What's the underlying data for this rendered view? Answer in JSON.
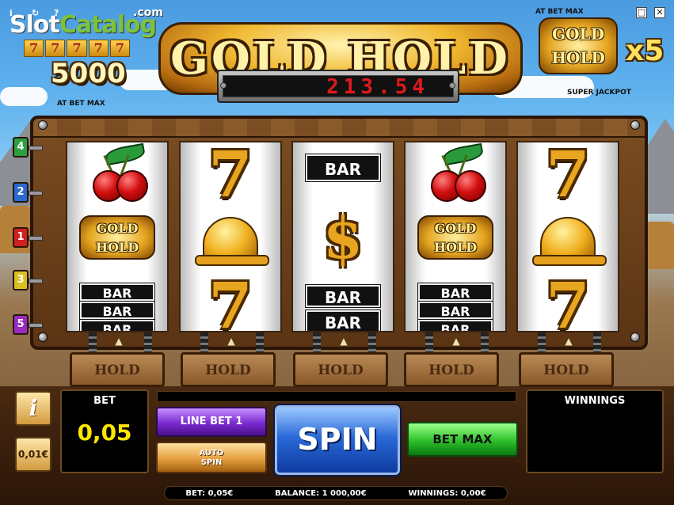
{
  "watermark": {
    "brand_a": "Slot",
    "brand_b": "Catalog",
    "suffix": ".com"
  },
  "window_controls": {
    "info": "i",
    "help": "?",
    "restore": "□",
    "close": "✕"
  },
  "left_jackpot": {
    "sevens": [
      "7",
      "7",
      "7",
      "7",
      "7"
    ],
    "value": "5000",
    "caption": "AT BET MAX"
  },
  "title": {
    "text": "GOLD HOLD"
  },
  "led_display": {
    "value": "213.54"
  },
  "right_jackpot": {
    "top_caption": "AT BET MAX",
    "logo_line1": "GOLD",
    "logo_line2": "HOLD",
    "multiplier": "x5",
    "bottom_caption": "SUPER JACKPOT"
  },
  "paylines": [
    {
      "number": "4",
      "color": "#2aa040"
    },
    {
      "number": "2",
      "color": "#2a6ad0"
    },
    {
      "number": "1",
      "color": "#d02020"
    },
    {
      "number": "3",
      "color": "#d8c020"
    },
    {
      "number": "5",
      "color": "#9a2ac0"
    }
  ],
  "reels": [
    {
      "top": "cherry",
      "mid": "goldhold",
      "bot": "bar3"
    },
    {
      "top": "seven",
      "mid": "bell",
      "bot": "seven"
    },
    {
      "top": "bar1",
      "mid": "dollar",
      "bot": "bar2"
    },
    {
      "top": "cherry",
      "mid": "goldhold",
      "bot": "bar3"
    },
    {
      "top": "seven",
      "mid": "bell",
      "bot": "seven"
    }
  ],
  "symbol_text": {
    "bar": "BAR",
    "seven": "7",
    "dollar": "$",
    "goldhold_1": "GOLD",
    "goldhold_2": "HOLD"
  },
  "hold_buttons": [
    "HOLD",
    "HOLD",
    "HOLD",
    "HOLD",
    "HOLD"
  ],
  "controls": {
    "info_label": "i",
    "coin_value": "0,01€",
    "bet_caption": "BET",
    "bet_value": "0,05",
    "line_bet_label": "LINE BET 1",
    "auto_spin_line1": "AUTO",
    "auto_spin_line2": "SPIN",
    "spin_label": "SPIN",
    "bet_max_label": "BET MAX",
    "winnings_caption": "WINNINGS"
  },
  "status_bar": {
    "bet": "BET: 0,05€",
    "balance": "BALANCE: 1 000,00€",
    "winnings": "WINNINGS: 0,00€"
  }
}
